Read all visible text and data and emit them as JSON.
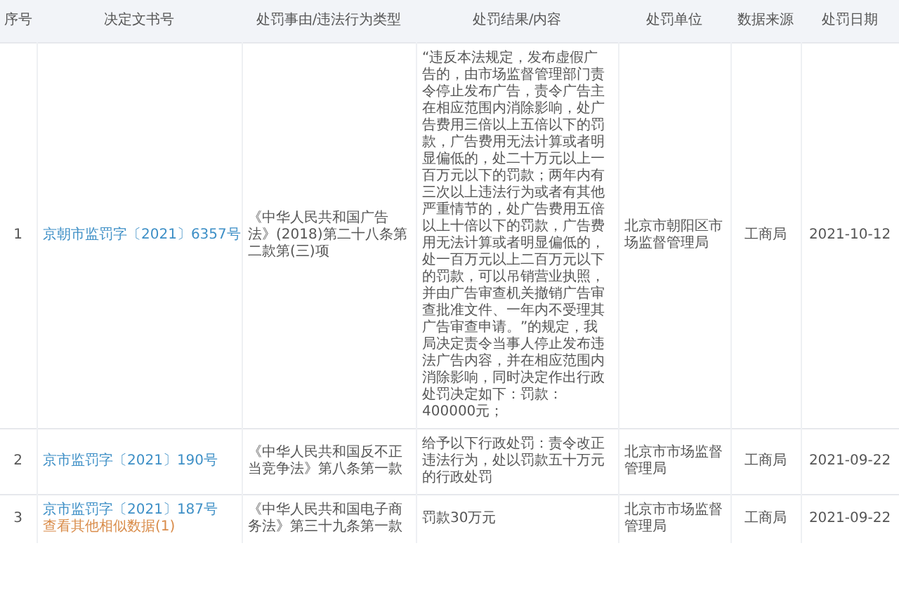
{
  "table": {
    "columns": [
      "序号",
      "决定文书号",
      "处罚事由/违法行为类型",
      "处罚结果/内容",
      "处罚单位",
      "数据来源",
      "处罚日期"
    ],
    "rows": [
      {
        "index": "1",
        "case_number": "京朝市监罚字〔2021〕6357号",
        "reason": "《中华人民共和国广告法》(2018)第二十八条第二款第(三)项",
        "result": "“违反本法规定，发布虚假广告的，由市场监督管理部门责令停止发布广告，责令广告主在相应范围内消除影响，处广告费用三倍以上五倍以下的罚款，广告费用无法计算或者明显偏低的，处二十万元以上一百万元以下的罚款；两年内有三次以上违法行为或者有其他严重情节的，处广告费用五倍以上十倍以下的罚款，广告费用无法计算或者明显偏低的，处一百万元以上二百万元以下的罚款，可以吊销营业执照，并由广告审查机关撤销广告审查批准文件、一年内不受理其广告审查申请。”的规定，我局决定责令当事人停止发布违法广告内容，并在相应范围内消除影响，同时决定作出行政处罚决定如下：罚款：400000元；",
        "unit": "北京市朝阳区市场监督管理局",
        "source": "工商局",
        "date": "2021-10-12"
      },
      {
        "index": "2",
        "case_number": "京市监罚字〔2021〕190号",
        "reason": "《中华人民共和国反不正当竞争法》第八条第一款",
        "result": "给予以下行政处罚：责令改正违法行为，处以罚款五十万元的行政处罚",
        "unit": "北京市市场监督管理局",
        "source": "工商局",
        "date": "2021-09-22"
      },
      {
        "index": "3",
        "case_number": "京市监罚字〔2021〕187号",
        "similar_link": "查看其他相似数据(1)",
        "reason": "《中华人民共和国电子商务法》第三十九条第一款",
        "result": "罚款30万元",
        "unit": "北京市市场监督管理局",
        "source": "工商局",
        "date": "2021-09-22"
      }
    ]
  }
}
